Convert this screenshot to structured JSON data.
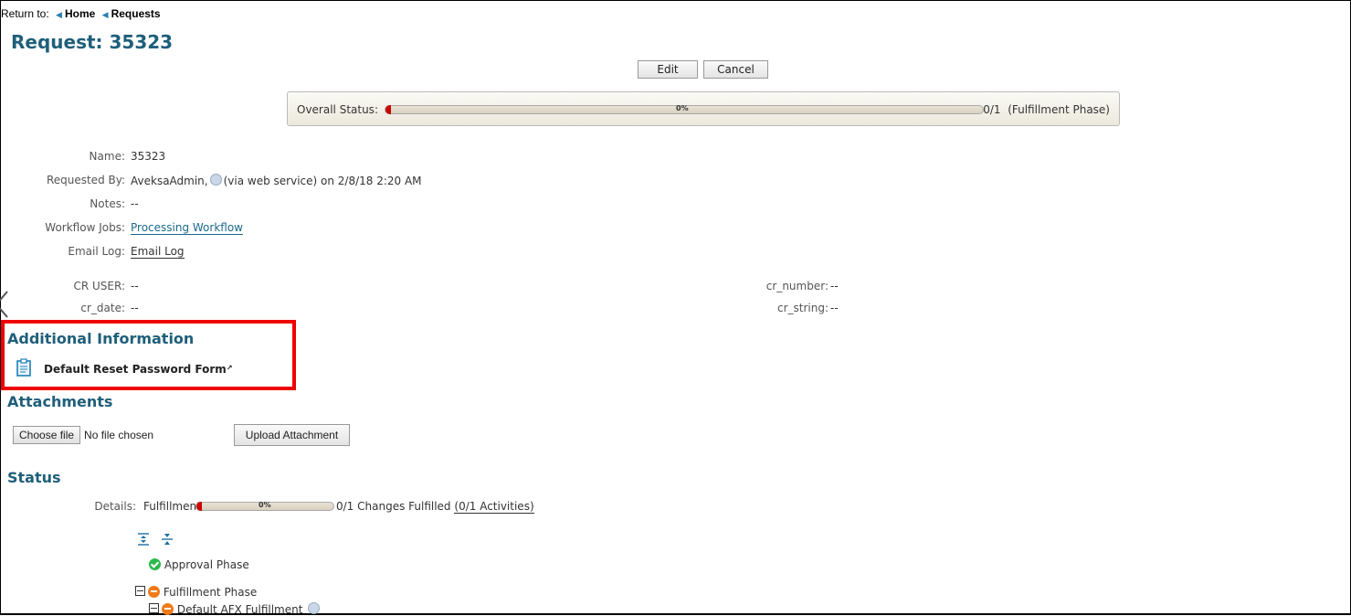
{
  "breadcrumb": {
    "prefix": "Return to:",
    "items": [
      "Home",
      "Requests"
    ]
  },
  "page_title": "Request: 35323",
  "actions": {
    "edit": "Edit",
    "cancel": "Cancel"
  },
  "overall_status": {
    "label": "Overall Status:",
    "percent": "0%",
    "progress": 0.0,
    "fraction": "0/1",
    "phase": "(Fulfillment Phase)"
  },
  "details": {
    "name_label": "Name:",
    "name": "35323",
    "requested_by_label": "Requested By:",
    "requested_by_user": "AveksaAdmin,",
    "requested_by_rest": "(via web service) on 2/8/18 2:20 AM",
    "notes_label": "Notes:",
    "notes": "--",
    "workflow_label": "Workflow Jobs:",
    "workflow_link": "Processing Workflow",
    "email_label": "Email Log:",
    "email_link": "Email Log",
    "cr_user_label": "CR USER:",
    "cr_user": "--",
    "cr_date_label": "cr_date:",
    "cr_date": "--",
    "cr_number_label": "cr_number:",
    "cr_number": "--",
    "cr_string_label": "cr_string:",
    "cr_string": "--"
  },
  "additional_info": {
    "heading": "Additional Information",
    "form_link": "Default Reset Password Form",
    "external_mark": "↗"
  },
  "attachments": {
    "heading": "Attachments",
    "choose_file": "Choose file",
    "no_file": "No file chosen",
    "upload": "Upload Attachment"
  },
  "status": {
    "heading": "Status",
    "details_label": "Details:",
    "fulfillment_label": "Fulfillment:",
    "percent": "0%",
    "progress": 0.0,
    "summary": "0/1 Changes Fulfilled",
    "activities": "(0/1 Activities)",
    "tree": [
      "Approval Phase",
      "Fulfillment Phase",
      "Default AFX Fulfillment"
    ]
  },
  "colors": {
    "heading": "#1f5f7a",
    "highlight": "#ee0000",
    "progress_fill": "#cc0000"
  }
}
